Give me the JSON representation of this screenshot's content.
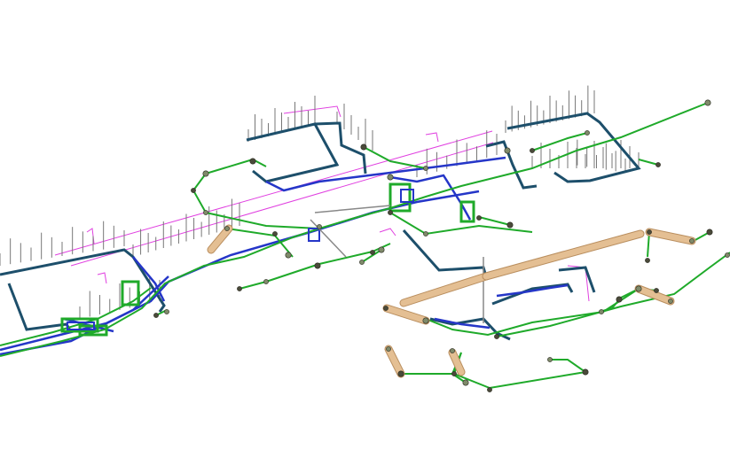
{
  "view": {
    "background": "#ffffff",
    "description_visible_text": ""
  },
  "palette": {
    "main_pipe": "#1faa2a",
    "main_pipe_light": "#39d53f",
    "blue_pipe": "#2536c8",
    "dark_teal": "#1d4f6b",
    "magenta": "#e040e0",
    "gray_stem": "#777777",
    "node": "#4a4a3a",
    "node_light": "#7f8a6a",
    "beam": "#e4bf93",
    "beam_edge": "#b98e5e"
  },
  "layers": [
    {
      "name": "drainage-network",
      "icon": "pipe-network-icon"
    },
    {
      "name": "water-supply",
      "icon": "blue-pipe-icon"
    },
    {
      "name": "gas-lines",
      "icon": "magenta-line-icon"
    },
    {
      "name": "structural-beams",
      "icon": "beam-icon"
    },
    {
      "name": "manholes",
      "icon": "node-icon"
    }
  ]
}
